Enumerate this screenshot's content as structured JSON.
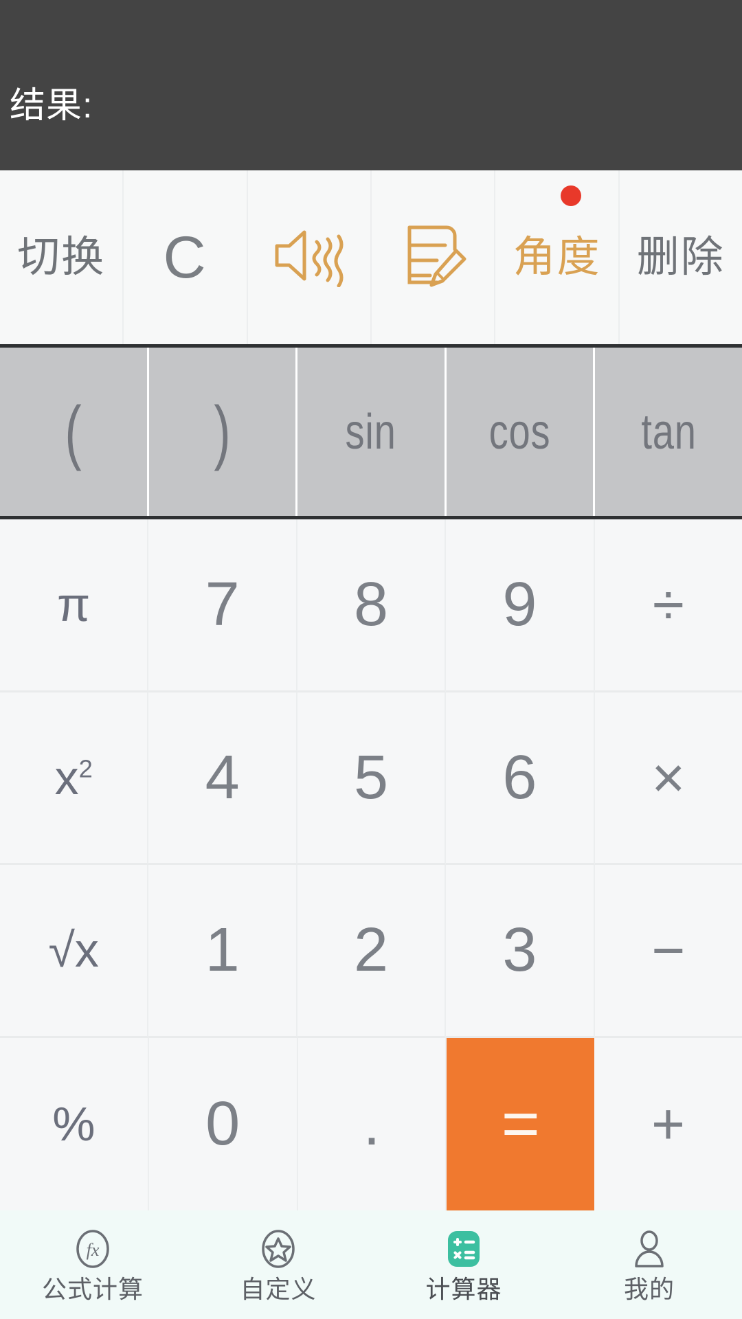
{
  "display": {
    "expression": "",
    "result_label": "结果:"
  },
  "toolbar": {
    "items": [
      {
        "label": "切换",
        "icon": "",
        "style": "text",
        "badge": false
      },
      {
        "label": "C",
        "icon": "",
        "style": "c-glyph",
        "badge": false
      },
      {
        "label": "",
        "icon": "sound-vibrate-icon",
        "style": "icon",
        "badge": false
      },
      {
        "label": "",
        "icon": "note-edit-icon",
        "style": "icon",
        "badge": false
      },
      {
        "label": "角度",
        "icon": "",
        "style": "amber",
        "badge": true
      },
      {
        "label": "删除",
        "icon": "",
        "style": "text",
        "badge": false
      }
    ]
  },
  "trig_row": {
    "keys": [
      {
        "label": "(",
        "kind": "paren",
        "name": "paren-open"
      },
      {
        "label": ")",
        "kind": "paren",
        "name": "paren-close"
      },
      {
        "label": "sin",
        "kind": "func",
        "name": "sin"
      },
      {
        "label": "cos",
        "kind": "func",
        "name": "cos"
      },
      {
        "label": "tan",
        "kind": "func",
        "name": "tan"
      }
    ]
  },
  "keypad": {
    "rows": [
      [
        {
          "label": "π",
          "kind": "func",
          "name": "pi"
        },
        {
          "label": "7",
          "kind": "digit",
          "name": "7"
        },
        {
          "label": "8",
          "kind": "digit",
          "name": "8"
        },
        {
          "label": "9",
          "kind": "digit",
          "name": "9"
        },
        {
          "label": "÷",
          "kind": "op",
          "name": "divide"
        }
      ],
      [
        {
          "label": "x²",
          "kind": "func",
          "name": "square"
        },
        {
          "label": "4",
          "kind": "digit",
          "name": "4"
        },
        {
          "label": "5",
          "kind": "digit",
          "name": "5"
        },
        {
          "label": "6",
          "kind": "digit",
          "name": "6"
        },
        {
          "label": "×",
          "kind": "op",
          "name": "multiply"
        }
      ],
      [
        {
          "label": "√x",
          "kind": "func",
          "name": "square-root"
        },
        {
          "label": "1",
          "kind": "digit",
          "name": "1"
        },
        {
          "label": "2",
          "kind": "digit",
          "name": "2"
        },
        {
          "label": "3",
          "kind": "digit",
          "name": "3"
        },
        {
          "label": "−",
          "kind": "op",
          "name": "minus"
        }
      ],
      [
        {
          "label": "%",
          "kind": "func",
          "name": "percent"
        },
        {
          "label": "0",
          "kind": "digit",
          "name": "0"
        },
        {
          "label": ".",
          "kind": "dot",
          "name": "decimal-point"
        },
        {
          "label": "=",
          "kind": "equals",
          "name": "equals"
        },
        {
          "label": "+",
          "kind": "op",
          "name": "plus"
        }
      ]
    ]
  },
  "bottom_nav": {
    "items": [
      {
        "label": "公式计算",
        "icon": "fx-circle-icon",
        "active": false
      },
      {
        "label": "自定义",
        "icon": "star-circle-icon",
        "active": false
      },
      {
        "label": "计算器",
        "icon": "calculator-icon",
        "active": true
      },
      {
        "label": "我的",
        "icon": "person-icon",
        "active": false
      }
    ]
  },
  "colors": {
    "display_bg": "#444444",
    "accent_orange": "#f0792f",
    "amber": "#d9a152",
    "badge_red": "#e8392a",
    "trig_bg": "#c4c5c7",
    "key_bg": "#f6f7f8",
    "nav_active_teal": "#3cbfa0"
  }
}
